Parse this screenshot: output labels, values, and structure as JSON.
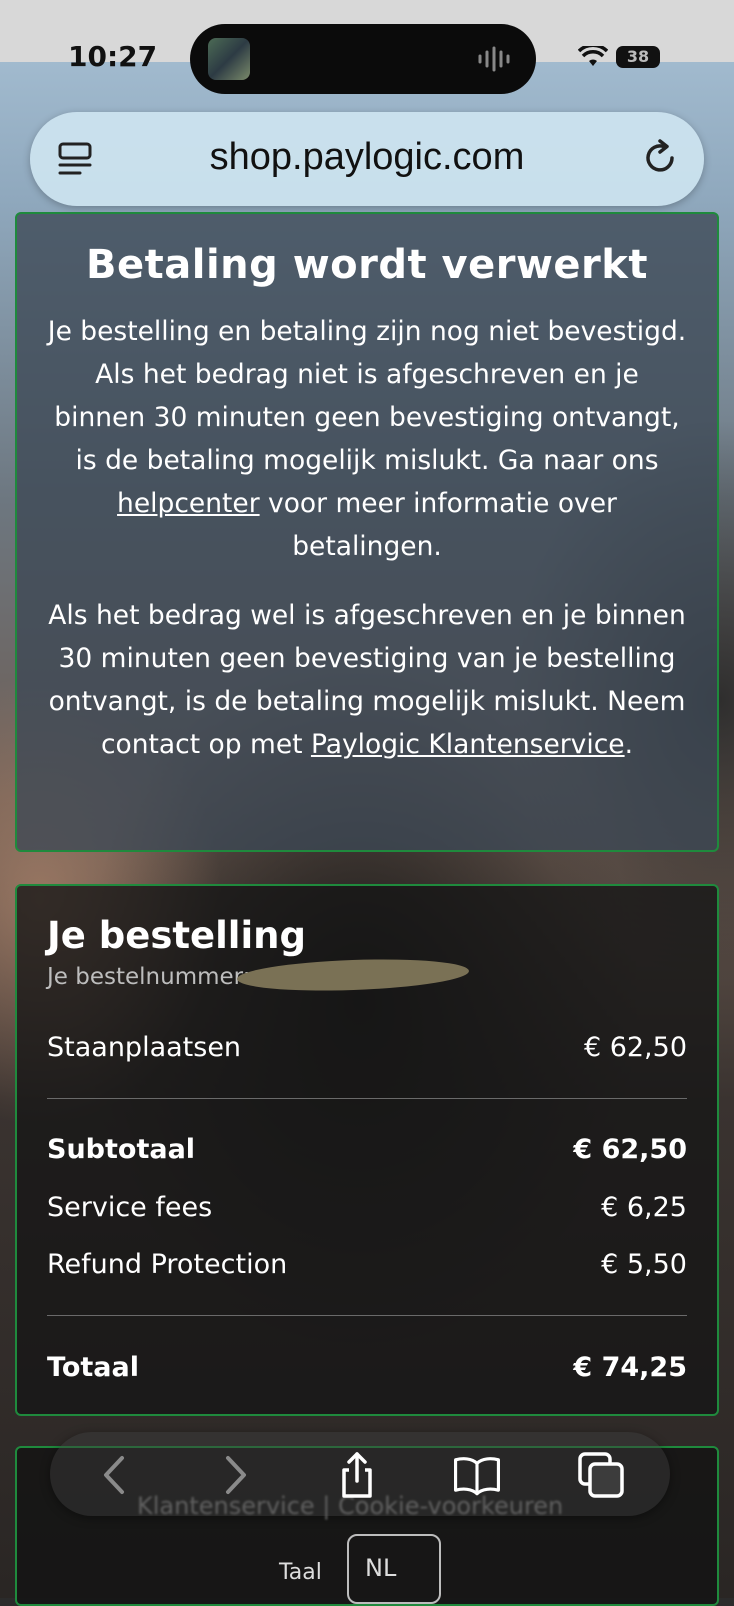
{
  "status_bar": {
    "time": "10:27",
    "battery": "38"
  },
  "browser": {
    "url": "shop.paylogic.com"
  },
  "processing": {
    "title": "Betaling wordt verwerkt",
    "p1_a": "Je bestelling en betaling zijn nog niet bevestigd. Als het bedrag niet is afgeschreven en je binnen 30 minuten geen bevestiging ontvangt, is de betaling mogelijk mislukt. Ga naar ons ",
    "p1_link": "helpcenter",
    "p1_b": " voor meer informatie over betalingen.",
    "p2_a": "Als het bedrag wel is afgeschreven en je binnen 30 minuten geen bevestiging van je bestelling ontvangt, is de betaling mogelijk mislukt. Neem contact op met ",
    "p2_link": "Paylogic Klantenservice",
    "p2_b": "."
  },
  "order": {
    "title": "Je bestelling",
    "number_label": "Je bestelnummer:",
    "items": [
      {
        "label": "Staanplaatsen",
        "value": "€ 62,50"
      }
    ],
    "subtotal": {
      "label": "Subtotaal",
      "value": "€ 62,50"
    },
    "fees": [
      {
        "label": "Service fees",
        "value": "€ 6,25"
      },
      {
        "label": "Refund Protection",
        "value": "€ 5,50"
      }
    ],
    "total": {
      "label": "Totaal",
      "value": "€ 74,25"
    }
  },
  "footer": {
    "links": "Klantenservice | Cookie-voorkeuren",
    "language_label": "Taal",
    "language": "NL"
  },
  "icons": {
    "tabs": "tabs-icon",
    "reload": "reload-icon",
    "back": "chevron-left-icon",
    "forward": "chevron-right-icon",
    "share": "share-icon",
    "bookmarks": "book-icon",
    "tab_overview": "tabs-overview-icon"
  }
}
